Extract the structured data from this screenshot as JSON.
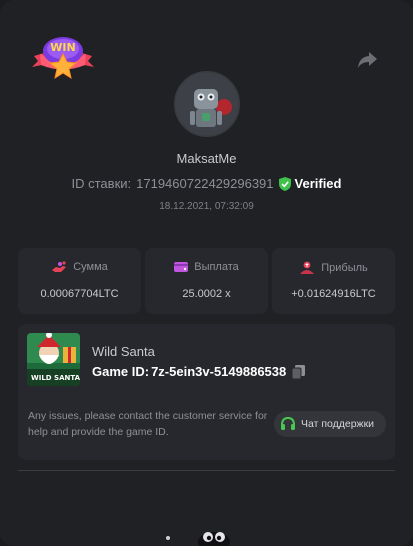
{
  "header": {
    "win_badge_text": "WIN",
    "share_icon": "share-arrow-icon"
  },
  "player": {
    "username": "MaksatMe",
    "bet_id_label": "ID ставки:",
    "bet_id": "1719460722429296391",
    "verified_label": "Verified",
    "datetime": "18.12.2021, 07:32:09"
  },
  "stats": [
    {
      "icon": "hand-coins-icon",
      "label": "Сумма",
      "value": "0.00067704LTC"
    },
    {
      "icon": "wallet-icon",
      "label": "Выплата",
      "value": "25.0002 x"
    },
    {
      "icon": "profit-user-icon",
      "label": "Прибыль",
      "value": "+0.01624916LTC"
    }
  ],
  "game": {
    "name": "Wild Santa",
    "thumb_text": "WILD SANTA",
    "id_label": "Game ID:",
    "id_value": "7z-5ein3v-5149886538",
    "issue_text": "Any issues, please contact the customer service for help and provide the game ID.",
    "support_label": "Чат поддержки"
  },
  "colors": {
    "background": "#202125",
    "card": "#27282d",
    "accent_red": "#e8425a",
    "accent_purple": "#c155e0",
    "verified_green": "#3ec24a",
    "support_green": "#46c94f"
  }
}
